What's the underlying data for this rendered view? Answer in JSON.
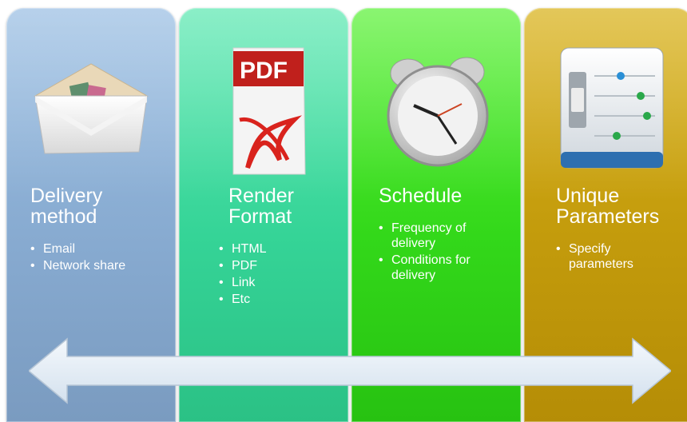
{
  "panels": [
    {
      "title": "Delivery\nmethod",
      "icon": "envelope-icon",
      "color": "#86a9cf",
      "bullets": [
        "Email",
        "Network share"
      ]
    },
    {
      "title": "Render\nFormat",
      "icon": "pdf-document-icon",
      "color": "#35d497",
      "bullets": [
        "HTML",
        "PDF",
        "Link",
        "Etc"
      ]
    },
    {
      "title": "Schedule",
      "icon": "alarm-clock-icon",
      "color": "#33d81a",
      "bullets": [
        "Frequency of\ndelivery",
        "Conditions for\ndelivery"
      ]
    },
    {
      "title": "Unique\nParameters",
      "icon": "settings-sliders-icon",
      "color": "#c39b0c",
      "bullets": [
        "Specify\nparameters"
      ]
    }
  ],
  "icons": {
    "pdf_label": "PDF"
  },
  "connector": {
    "icon": "double-headed-arrow-icon",
    "color": "#dfeaf5"
  }
}
